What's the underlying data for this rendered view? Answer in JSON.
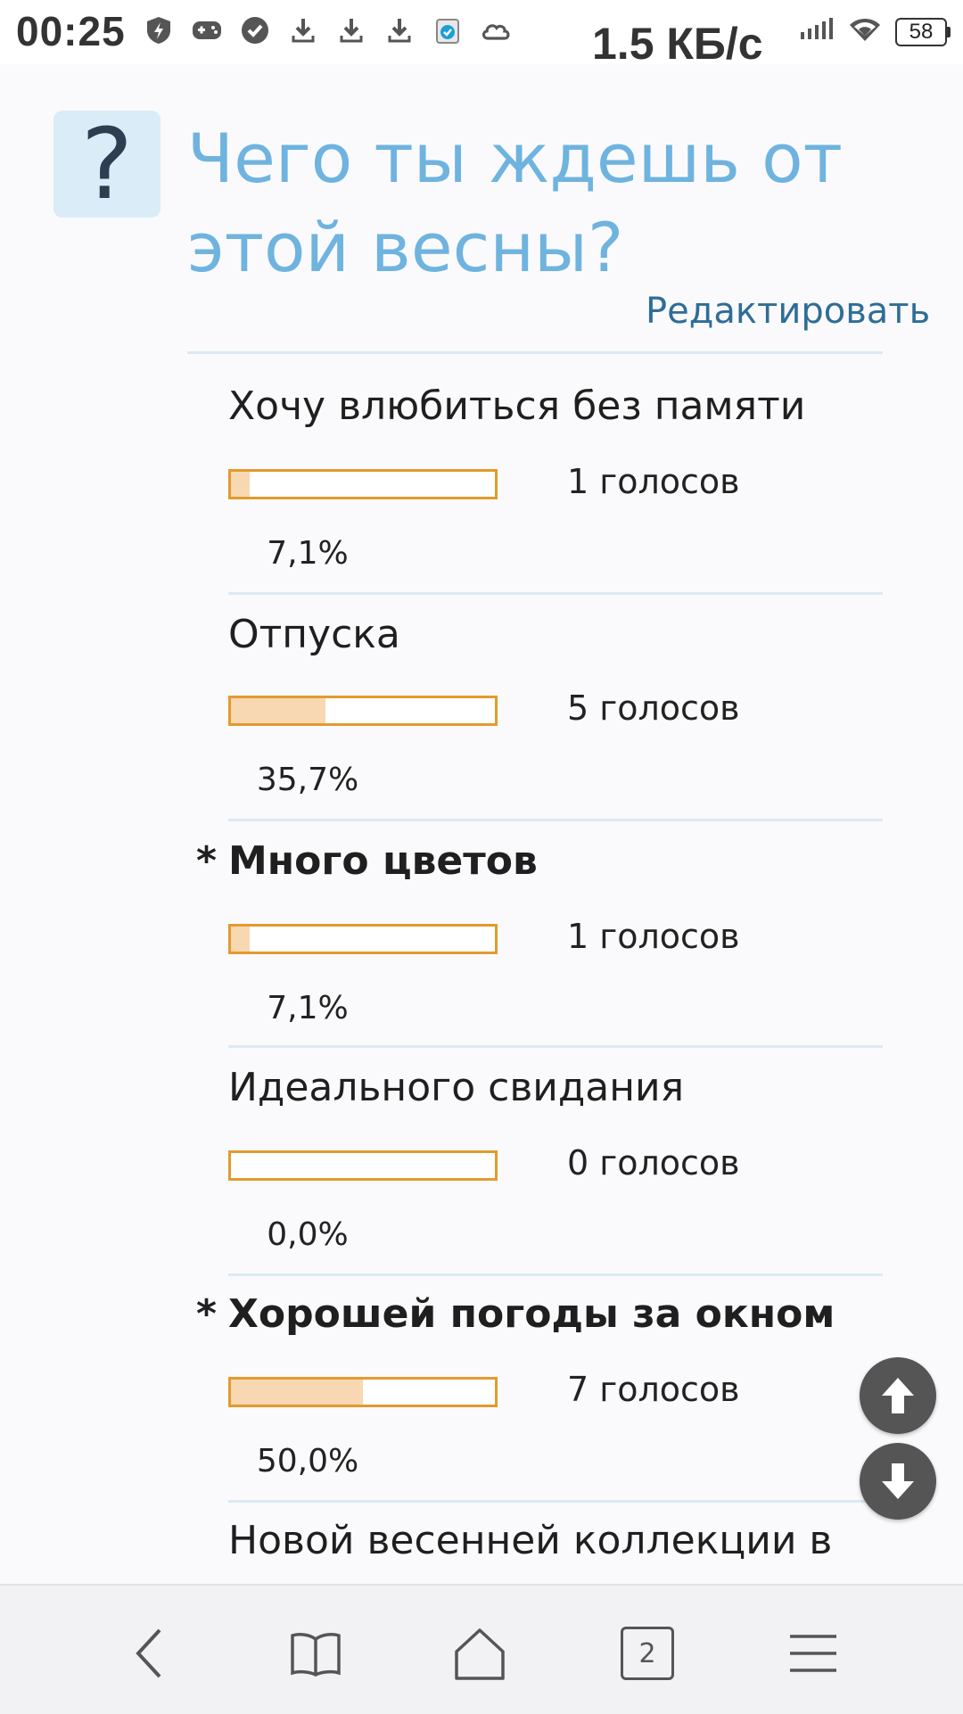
{
  "status_bar": {
    "time": "00:25",
    "speed": "1.5 КБ/с",
    "battery": "58",
    "icons": [
      "shield-bolt-icon",
      "gamepad-icon",
      "check-circle-icon",
      "download-icon",
      "download-icon",
      "download-icon",
      "app-badge-icon",
      "cloud-icon"
    ]
  },
  "poll": {
    "question_mark": "?",
    "title": "Чего ты ждешь от этой весны?",
    "edit_label": "Редактировать",
    "options": [
      {
        "label": "Хочу влюбиться без памяти",
        "votes": "1 голосов",
        "percent": "7,1%",
        "fill": 7.1,
        "starred": false
      },
      {
        "label": "Отпуска",
        "votes": "5 голосов",
        "percent": "35,7%",
        "fill": 35.7,
        "starred": false
      },
      {
        "label": "Много цветов",
        "votes": "1 голосов",
        "percent": "7,1%",
        "fill": 7.1,
        "starred": true
      },
      {
        "label": "Идеального свидания",
        "votes": "0 голосов",
        "percent": "0,0%",
        "fill": 0.0,
        "starred": false
      },
      {
        "label": "Хорошей погоды за окном",
        "votes": "7 голосов",
        "percent": "50,0%",
        "fill": 50.0,
        "starred": true
      },
      {
        "label": "Новой весенней коллекции в",
        "votes": "",
        "percent": "",
        "fill": null,
        "starred": false
      }
    ],
    "star_mark": "*"
  },
  "bottom_nav": {
    "tabs_count": "2",
    "items": [
      "back-icon",
      "bookmarks-icon",
      "home-icon",
      "tabs-icon",
      "menu-icon"
    ]
  },
  "colors": {
    "title": "#6fb3df",
    "bar_border": "#e39a2d",
    "bar_fill": "#f8d8b3",
    "edit_link": "#2f6d96"
  }
}
